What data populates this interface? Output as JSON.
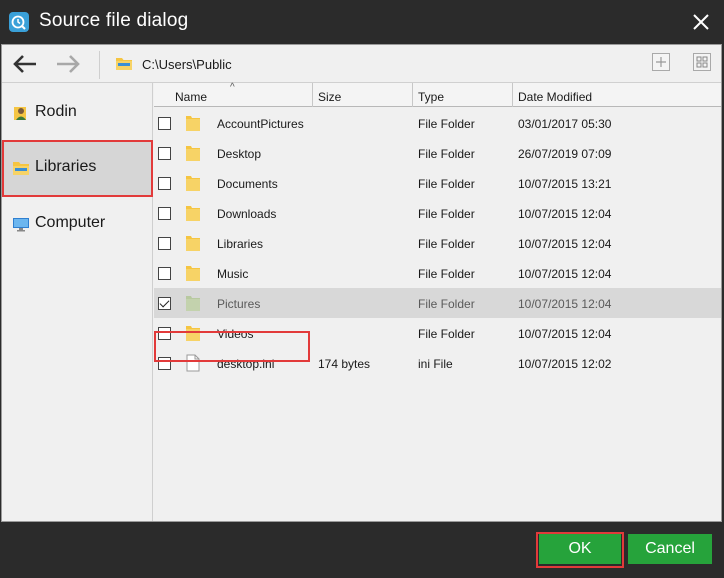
{
  "window": {
    "title": "Source file dialog",
    "app_icon": "backup-app-icon",
    "close_icon": "close-icon"
  },
  "toolbar": {
    "back_icon": "arrow-left-icon",
    "forward_icon": "arrow-right-icon",
    "path_icon": "library-folder-icon",
    "path": "C:\\Users\\Public",
    "new_folder_icon": "new-folder-icon",
    "view_icon": "grid-view-icon"
  },
  "sidebar": {
    "items": [
      {
        "label": "Rodin",
        "icon": "user-icon"
      },
      {
        "label": "Libraries",
        "icon": "library-folder-icon",
        "selected": true
      },
      {
        "label": "Computer",
        "icon": "monitor-icon"
      }
    ]
  },
  "list": {
    "columns": {
      "name": "Name",
      "size": "Size",
      "type": "Type",
      "date": "Date Modified"
    },
    "sort_indicator": "^",
    "rows": [
      {
        "name": "AccountPictures",
        "size": "",
        "type": "File Folder",
        "date": "03/01/2017 05:30",
        "icon": "folder-icon",
        "checked": false
      },
      {
        "name": "Desktop",
        "size": "",
        "type": "File Folder",
        "date": "26/07/2019 07:09",
        "icon": "folder-icon",
        "checked": false
      },
      {
        "name": "Documents",
        "size": "",
        "type": "File Folder",
        "date": "10/07/2015 13:21",
        "icon": "folder-icon",
        "checked": false
      },
      {
        "name": "Downloads",
        "size": "",
        "type": "File Folder",
        "date": "10/07/2015 12:04",
        "icon": "folder-icon",
        "checked": false
      },
      {
        "name": "Libraries",
        "size": "",
        "type": "File Folder",
        "date": "10/07/2015 12:04",
        "icon": "folder-icon",
        "checked": false
      },
      {
        "name": "Music",
        "size": "",
        "type": "File Folder",
        "date": "10/07/2015 12:04",
        "icon": "folder-icon",
        "checked": false
      },
      {
        "name": "Pictures",
        "size": "",
        "type": "File Folder",
        "date": "10/07/2015 12:04",
        "icon": "folder-icon",
        "checked": true
      },
      {
        "name": "Videos",
        "size": "",
        "type": "File Folder",
        "date": "10/07/2015 12:04",
        "icon": "folder-icon",
        "checked": false
      },
      {
        "name": "desktop.ini",
        "size": "174 bytes",
        "type": "ini File",
        "date": "10/07/2015 12:02",
        "icon": "file-icon",
        "checked": false
      }
    ]
  },
  "footer": {
    "ok_label": "OK",
    "cancel_label": "Cancel"
  },
  "colors": {
    "title_bar": "#2b2b2b",
    "panel": "#f0f0f0",
    "button_green": "#26a33b",
    "highlight_red": "#e23a3a",
    "folder_yellow": "#f5c542"
  }
}
